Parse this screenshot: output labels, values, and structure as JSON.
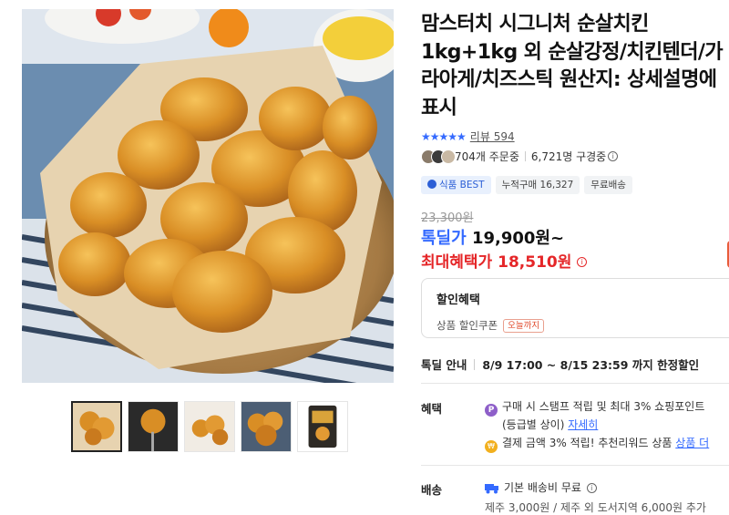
{
  "product": {
    "title": "맘스터치 시그니처 순살치킨 1kg+1kg 외 순살강정/치킨텐더/가라아게/치즈스틱 원산지: 상세설명에 표시",
    "rating_stars": "★★★★★",
    "review_label": "리뷰 594",
    "orders": "704개 주문중",
    "watchers": "6,721명 구경중"
  },
  "tags": {
    "best": "식품 BEST",
    "cumulative": "누적구매 16,327",
    "free_ship": "무료배송"
  },
  "price": {
    "original": "23,300원",
    "deal_label": "톡딜가",
    "deal_value": "19,900원~",
    "max_label": "최대혜택가",
    "max_value": "18,510원"
  },
  "discount": {
    "title": "할인혜택",
    "coupon_text": "상품 할인쿠폰",
    "coupon_chip": "오늘까지"
  },
  "deal_notice": {
    "label": "톡딜 안내",
    "text": "8/9 17:00 ~ 8/15 23:59 까지 한정할인"
  },
  "benefits": {
    "label": "혜택",
    "line1": "구매 시 스탬프 적립 및 최대 3% 쇼핑포인트",
    "line1b": "(등급별 상이)",
    "detail_link": "자세히",
    "line2": "결제 금액 3% 적립! 추천리워드 상품",
    "line2_link": "상품 더"
  },
  "shipping": {
    "label": "배송",
    "line1": "기본 배송비 무료",
    "line2": "제주 3,000원 / 제주 외 도서지역 6,000원 추가"
  },
  "colors": {
    "accent_blue": "#346aff",
    "price_red": "#e52628"
  },
  "icons": {
    "info": "info-icon",
    "stamp": "p-icon",
    "coin": "coin-icon",
    "truck": "truck-icon"
  }
}
